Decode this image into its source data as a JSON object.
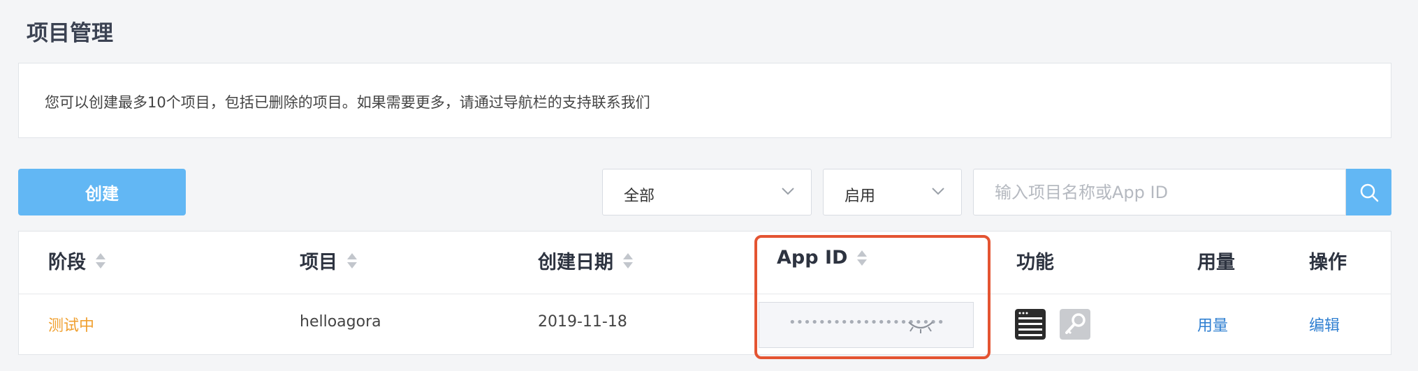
{
  "page": {
    "title": "项目管理",
    "notice": "您可以创建最多10个项目，包括已删除的项目。如果需要更多，请通过导航栏的支持联系我们"
  },
  "toolbar": {
    "create_label": "创建",
    "filter_status": "全部",
    "filter_enabled": "启用",
    "search_placeholder": "输入项目名称或App ID"
  },
  "table": {
    "headers": {
      "stage": "阶段",
      "project": "项目",
      "created": "创建日期",
      "app_id": "App ID",
      "features": "功能",
      "usage": "用量",
      "actions": "操作"
    },
    "rows": [
      {
        "stage": "测试中",
        "project": "helloagora",
        "created": "2019-11-18",
        "app_id_masked": "•••••••••••••••••••••",
        "features": [
          "list-icon",
          "key-icon"
        ],
        "usage_link": "用量",
        "action_link": "编辑"
      }
    ]
  },
  "colors": {
    "accent": "#62b7f4",
    "highlight": "#e45432",
    "stage_testing": "#f0a030",
    "link": "#2f7fd1"
  }
}
